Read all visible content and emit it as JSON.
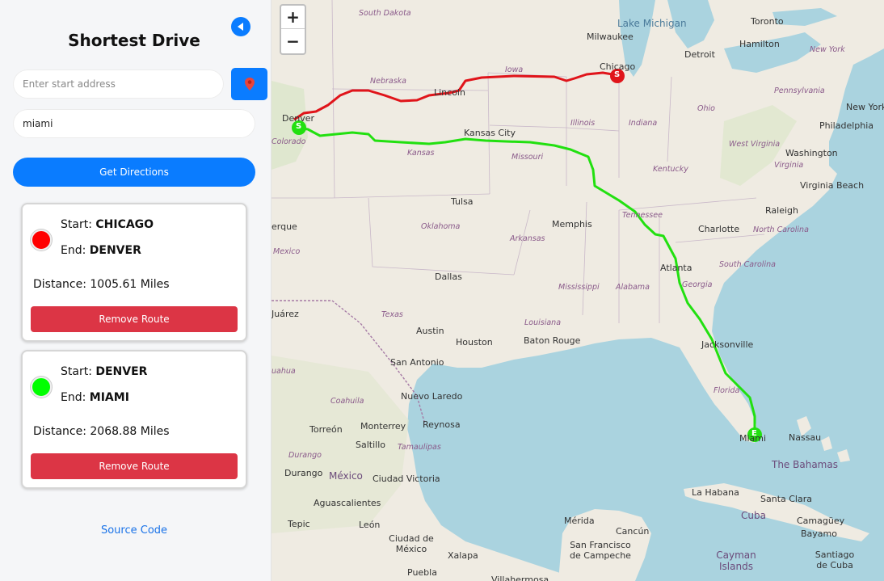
{
  "sidebar": {
    "title": "Shortest Drive",
    "start_placeholder": "Enter start address",
    "start_value": "",
    "end_value": "miami",
    "get_directions_label": "Get Directions",
    "source_code_label": "Source Code",
    "start_label": "Start:",
    "end_label": "End:",
    "distance_label": "Distance:",
    "remove_label": "Remove Route",
    "routes": [
      {
        "color": "#ff0000",
        "start": "CHICAGO",
        "end": "DENVER",
        "distance": "1005.61 Miles"
      },
      {
        "color": "#00ff00",
        "start": "DENVER",
        "end": "MIAMI",
        "distance": "2068.88 Miles"
      }
    ]
  },
  "map": {
    "zoom_in": "+",
    "zoom_out": "−",
    "marker_start": "S",
    "marker_end": "E",
    "route_colors": [
      "#e0141a",
      "#22e010"
    ],
    "labels": {
      "south_dakota": "South Dakota",
      "lake_michigan": "Lake Michigan",
      "toronto": "Toronto",
      "milwaukee": "Milwaukee",
      "detroit": "Detroit",
      "hamilton": "Hamilton",
      "new_york_state": "New York",
      "chicago": "Chicago",
      "iowa": "Iowa",
      "nebraska": "Nebraska",
      "lincoln": "Lincoln",
      "pennsylvania": "Pennsylvania",
      "ohio": "Ohio",
      "new_york_city": "New York",
      "denver": "Denver",
      "colorado": "Colorado",
      "illinois": "Illinois",
      "indiana": "Indiana",
      "philadelphia": "Philadelphia",
      "kansas_city": "Kansas City",
      "west_virginia": "West Virginia",
      "washington": "Washington",
      "virginia": "Virginia",
      "kansas": "Kansas",
      "missouri": "Missouri",
      "kentucky": "Kentucky",
      "virginia_beach": "Virginia Beach",
      "tulsa": "Tulsa",
      "tennessee": "Tennessee",
      "raleigh": "Raleigh",
      "albuquerque": "erque",
      "oklahoma": "Oklahoma",
      "memphis": "Memphis",
      "charlotte": "Charlotte",
      "north_carolina": "North Carolina",
      "arkansas": "Arkansas",
      "new_mexico": "Mexico",
      "atlanta": "Atlanta",
      "south_carolina": "South Carolina",
      "dallas": "Dallas",
      "mississippi": "Mississippi",
      "alabama": "Alabama",
      "georgia": "Georgia",
      "juarez": "Juárez",
      "texas": "Texas",
      "louisiana": "Louisiana",
      "austin": "Austin",
      "houston": "Houston",
      "baton_rouge": "Baton Rouge",
      "jacksonville": "Jacksonville",
      "san_antonio": "San Antonio",
      "chihuahua": "uahua",
      "florida": "Florida",
      "coahuila": "Coahuila",
      "nuevo_laredo": "Nuevo Laredo",
      "torreon": "Torreón",
      "monterrey": "Monterrey",
      "reynosa": "Reynosa",
      "miami": "Miami",
      "nassau": "Nassau",
      "saltillo": "Saltillo",
      "tamaulipas": "Tamaulipas",
      "the_bahamas": "The Bahamas",
      "durango_state": "Durango",
      "durango": "Durango",
      "mexico": "México",
      "ciudad_victoria": "Ciudad Victoria",
      "la_habana": "La Habana",
      "santa_clara": "Santa Clara",
      "aguascalientes": "Aguascalientes",
      "cuba": "Cuba",
      "camaguey": "Camagüey",
      "merida": "Mérida",
      "cancun": "Cancún",
      "tepic": "Tepic",
      "leon": "León",
      "bayamo": "Bayamo",
      "ciudad_de_mexico": "Ciudad de México",
      "san_francisco": "San Francisco de Campeche",
      "cayman": "Cayman Islands",
      "xalapa": "Xalapa",
      "santiago": "Santiago de Cuba",
      "puebla": "Puebla",
      "villahermosa": "Villahermosa"
    }
  }
}
